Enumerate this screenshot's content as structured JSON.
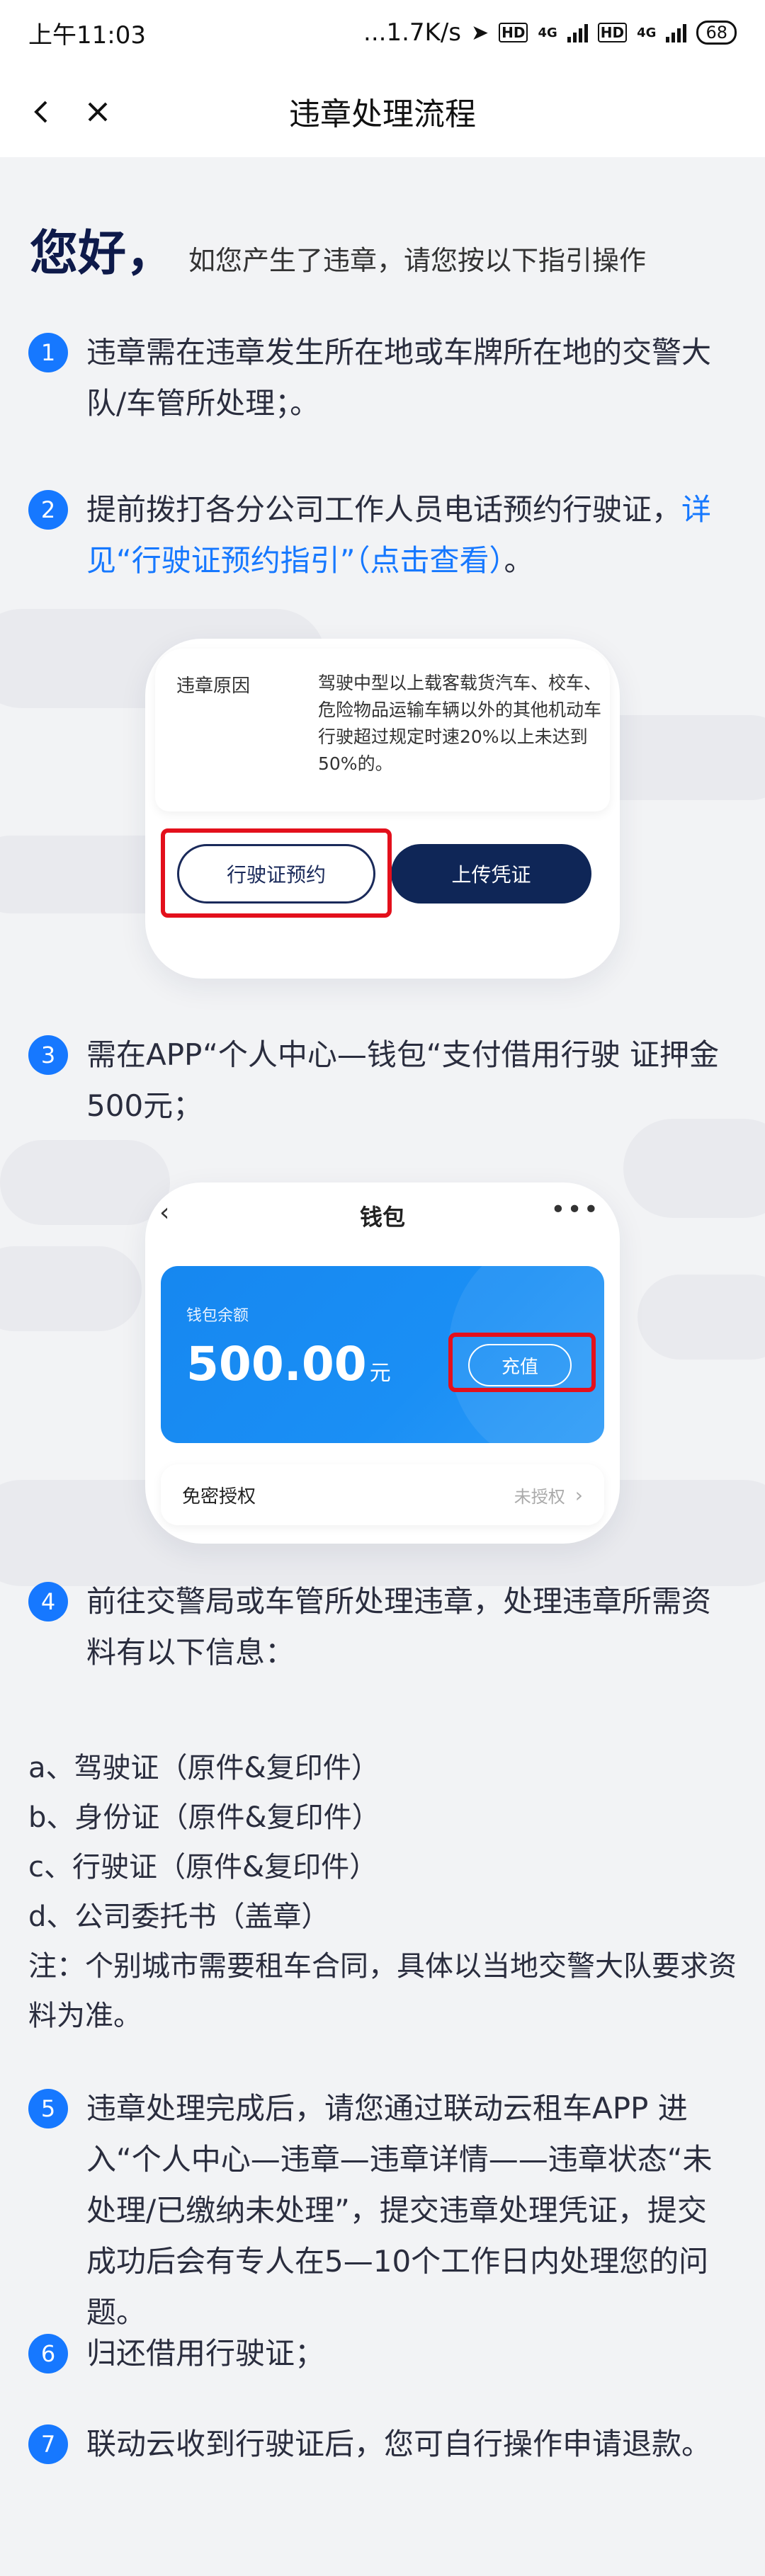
{
  "status_bar": {
    "time": "上午11:03",
    "net_speed": "...1.7K/s",
    "signal1": "4G",
    "signal2": "4G",
    "hd": "HD",
    "battery": "68"
  },
  "nav": {
    "title": "违章处理流程"
  },
  "greeting": {
    "hello": "您好，",
    "intro": "如您产生了违章，请您按以下指引操作"
  },
  "steps": [
    {
      "num": "1",
      "text": "违章需在违章发生所在地或车牌所在地的交警大队/车管所处理；。"
    },
    {
      "num": "2",
      "text": "提前拨打各分公司工作人员电话预约行驶证，",
      "link": "详见“行驶证预约指引”（点击查看）",
      "tail": "。"
    },
    {
      "num": "3",
      "text": "需在APP“个人中心—钱包“支付借用行驶 证押金500元；"
    },
    {
      "num": "4",
      "text": "前往交警局或车管所处理违章，处理违章所需资料有以下信息："
    },
    {
      "num": "5",
      "text": "违章处理完成后，请您通过联动云租车APP 进入“个人中心—违章—违章详情——违章状态“未处理/已缴纳未处理”，提交违章处理凭证，提交成功后会有专人在5—10个工作日内处理您的问题。"
    },
    {
      "num": "6",
      "text": "归还借用行驶证；"
    },
    {
      "num": "7",
      "text": "联动云收到行驶证后，您可自行操作申请退款。"
    }
  ],
  "materials": [
    "a、驾驶证（原件&复印件）",
    "b、身份证（原件&复印件）",
    "c、行驶证（原件&复印件）",
    "d、公司委托书（盖章）",
    "注：个别城市需要租车合同，具体以当地交警大队要求资料为准。"
  ],
  "card1": {
    "label": "违章原因",
    "desc": "驾驶中型以上载客载货汽车、校车、危险物品运输车辆以外的其他机动车行驶超过规定时速20%以上未达到50%的。",
    "btn_reserve": "行驶证预约",
    "btn_upload": "上传凭证"
  },
  "card2": {
    "title": "钱包",
    "balance_label": "钱包余额",
    "amount": "500.00",
    "unit": "元",
    "recharge": "充值",
    "row_label": "免密授权",
    "row_status": "未授权"
  },
  "colors": {
    "accent": "#1678ff",
    "dark_blue": "#0f2657",
    "highlight_red": "#e3101c"
  }
}
